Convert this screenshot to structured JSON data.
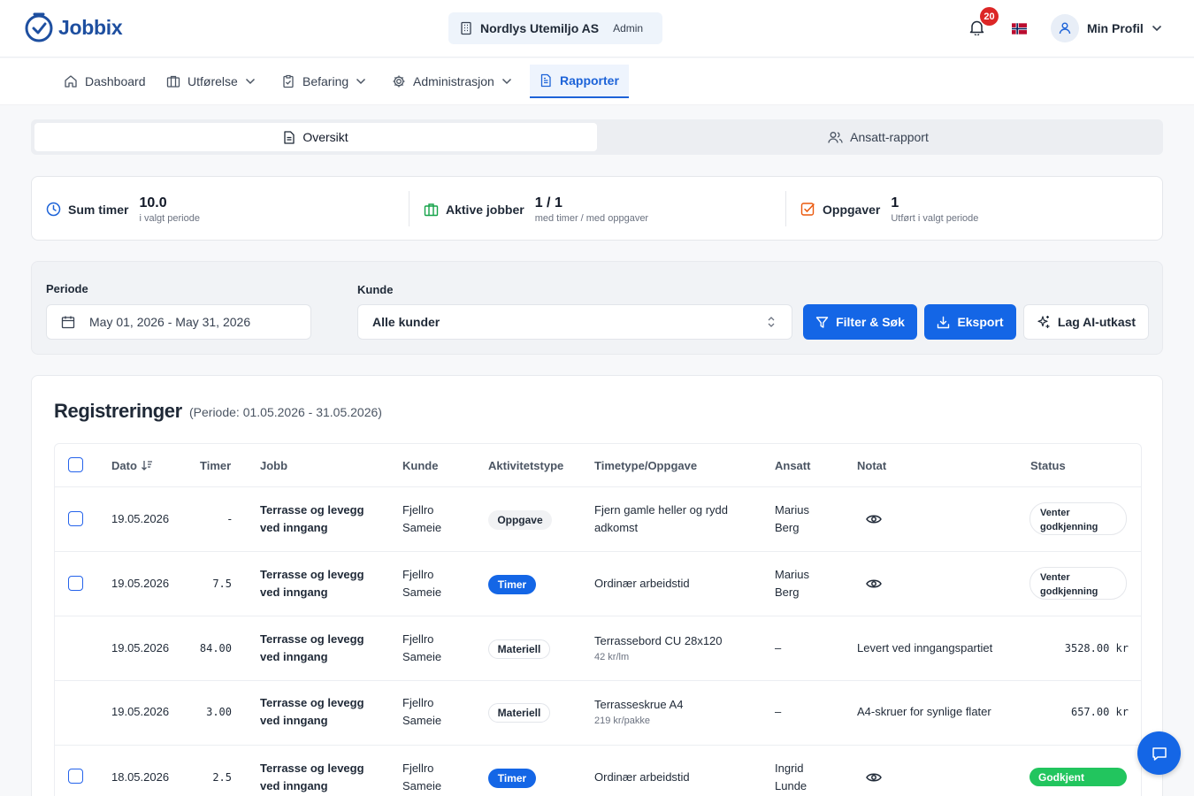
{
  "header": {
    "logo_text": "Jobbix",
    "company_name": "Nordlys Utemiljo AS",
    "company_role": "Admin",
    "notification_count": "20",
    "profile_label": "Min Profil"
  },
  "nav": {
    "dashboard": "Dashboard",
    "utforelse": "Utførelse",
    "befaring": "Befaring",
    "administrasjon": "Administrasjon",
    "rapporter": "Rapporter"
  },
  "tabs": {
    "oversikt": "Oversikt",
    "ansatt_rapport": "Ansatt-rapport"
  },
  "stats": {
    "sum_timer": {
      "label": "Sum timer",
      "value": "10.0",
      "sub": "i valgt periode"
    },
    "aktive_jobber": {
      "label": "Aktive jobber",
      "value": "1 / 1",
      "sub": "med timer / med oppgaver"
    },
    "oppgaver": {
      "label": "Oppgaver",
      "value": "1",
      "sub": "Utført i valgt periode"
    }
  },
  "filters": {
    "periode_label": "Periode",
    "periode_value": "May 01, 2026 - May 31, 2026",
    "kunde_label": "Kunde",
    "kunde_value": "Alle kunder",
    "filter_button": "Filter & Søk",
    "export_button": "Eksport",
    "ai_button": "Lag AI-utkast"
  },
  "registrations": {
    "title": "Registreringer",
    "period": "(Periode: 01.05.2026 - 31.05.2026)",
    "columns": {
      "dato": "Dato",
      "timer": "Timer",
      "jobb": "Jobb",
      "kunde": "Kunde",
      "aktivitet": "Aktivitetstype",
      "timetype": "Timetype/Oppgave",
      "ansatt": "Ansatt",
      "notat": "Notat",
      "status": "Status"
    },
    "rows": [
      {
        "dato": "19.05.2026",
        "timer": "-",
        "jobb1": "Terrasse og levegg",
        "jobb2": "ved inngang",
        "kunde1": "Fjellro",
        "kunde2": "Sameie",
        "aktivitet": "Oppgave",
        "timetype": "Fjern gamle heller og rydd",
        "timetype2": "adkomst",
        "ansatt1": "Marius",
        "ansatt2": "Berg",
        "status1": "Venter",
        "status2": "godkjenning"
      },
      {
        "dato": "19.05.2026",
        "timer": "7.5",
        "jobb1": "Terrasse og levegg",
        "jobb2": "ved inngang",
        "kunde1": "Fjellro",
        "kunde2": "Sameie",
        "aktivitet": "Timer",
        "timetype": "Ordinær arbeidstid",
        "ansatt1": "Marius",
        "ansatt2": "Berg",
        "status1": "Venter",
        "status2": "godkjenning"
      },
      {
        "dato": "19.05.2026",
        "timer": "84.00",
        "jobb1": "Terrasse og levegg",
        "jobb2": "ved inngang",
        "kunde1": "Fjellro",
        "kunde2": "Sameie",
        "aktivitet": "Materiell",
        "timetype": "Terrassebord CU 28x120",
        "timetype_sub": "42 kr/lm",
        "ansatt": "–",
        "notat": "Levert ved inngangspartiet",
        "amount": "3528.00 kr"
      },
      {
        "dato": "19.05.2026",
        "timer": "3.00",
        "jobb1": "Terrasse og levegg",
        "jobb2": "ved inngang",
        "kunde1": "Fjellro",
        "kunde2": "Sameie",
        "aktivitet": "Materiell",
        "timetype": "Terrasseskrue A4",
        "timetype_sub": "219 kr/pakke",
        "ansatt": "–",
        "notat": "A4-skruer for synlige flater",
        "amount": "657.00 kr"
      },
      {
        "dato": "18.05.2026",
        "timer": "2.5",
        "jobb1": "Terrasse og levegg",
        "jobb2": "ved inngang",
        "kunde1": "Fjellro",
        "kunde2": "Sameie",
        "aktivitet": "Timer",
        "timetype": "Ordinær arbeidstid",
        "ansatt1": "Ingrid",
        "ansatt2": "Lunde",
        "status": "Godkjent"
      }
    ]
  }
}
